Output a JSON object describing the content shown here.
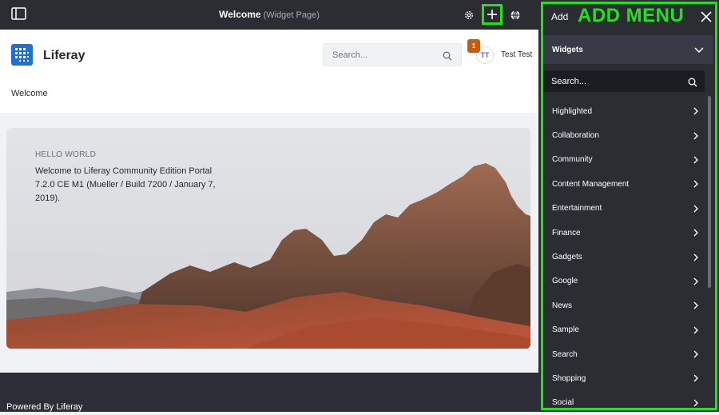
{
  "topbar": {
    "page_title": "Welcome",
    "page_type": "(Widget Page)",
    "icons": [
      "panel-toggle-icon",
      "gear-icon",
      "plus-icon",
      "simulation-icon"
    ]
  },
  "header": {
    "brand": "Liferay",
    "search_placeholder": "Search...",
    "notification_count": "1",
    "avatar_initials": "TT",
    "user_name": "Test Test",
    "nav_item": "Welcome"
  },
  "banner": {
    "kicker": "HELLO WORLD",
    "text": "Welcome to Liferay Community Edition Portal 7.2.0 CE M1 (Mueller / Build 7200 / January 7, 2019)."
  },
  "footer": {
    "text": "Powered By Liferay"
  },
  "add_panel": {
    "title": "Add",
    "annotation": "ADD MENU",
    "section": "Widgets",
    "search_placeholder": "Search...",
    "categories": [
      "Highlighted",
      "Collaboration",
      "Community",
      "Content Management",
      "Entertainment",
      "Finance",
      "Gadgets",
      "Google",
      "News",
      "Sample",
      "Search",
      "Shopping",
      "Social"
    ]
  },
  "colors": {
    "highlight": "#22e11e",
    "dark_panel": "#2b2d33",
    "brand_blue": "#1f6fd6",
    "notification": "#c25d0d"
  }
}
